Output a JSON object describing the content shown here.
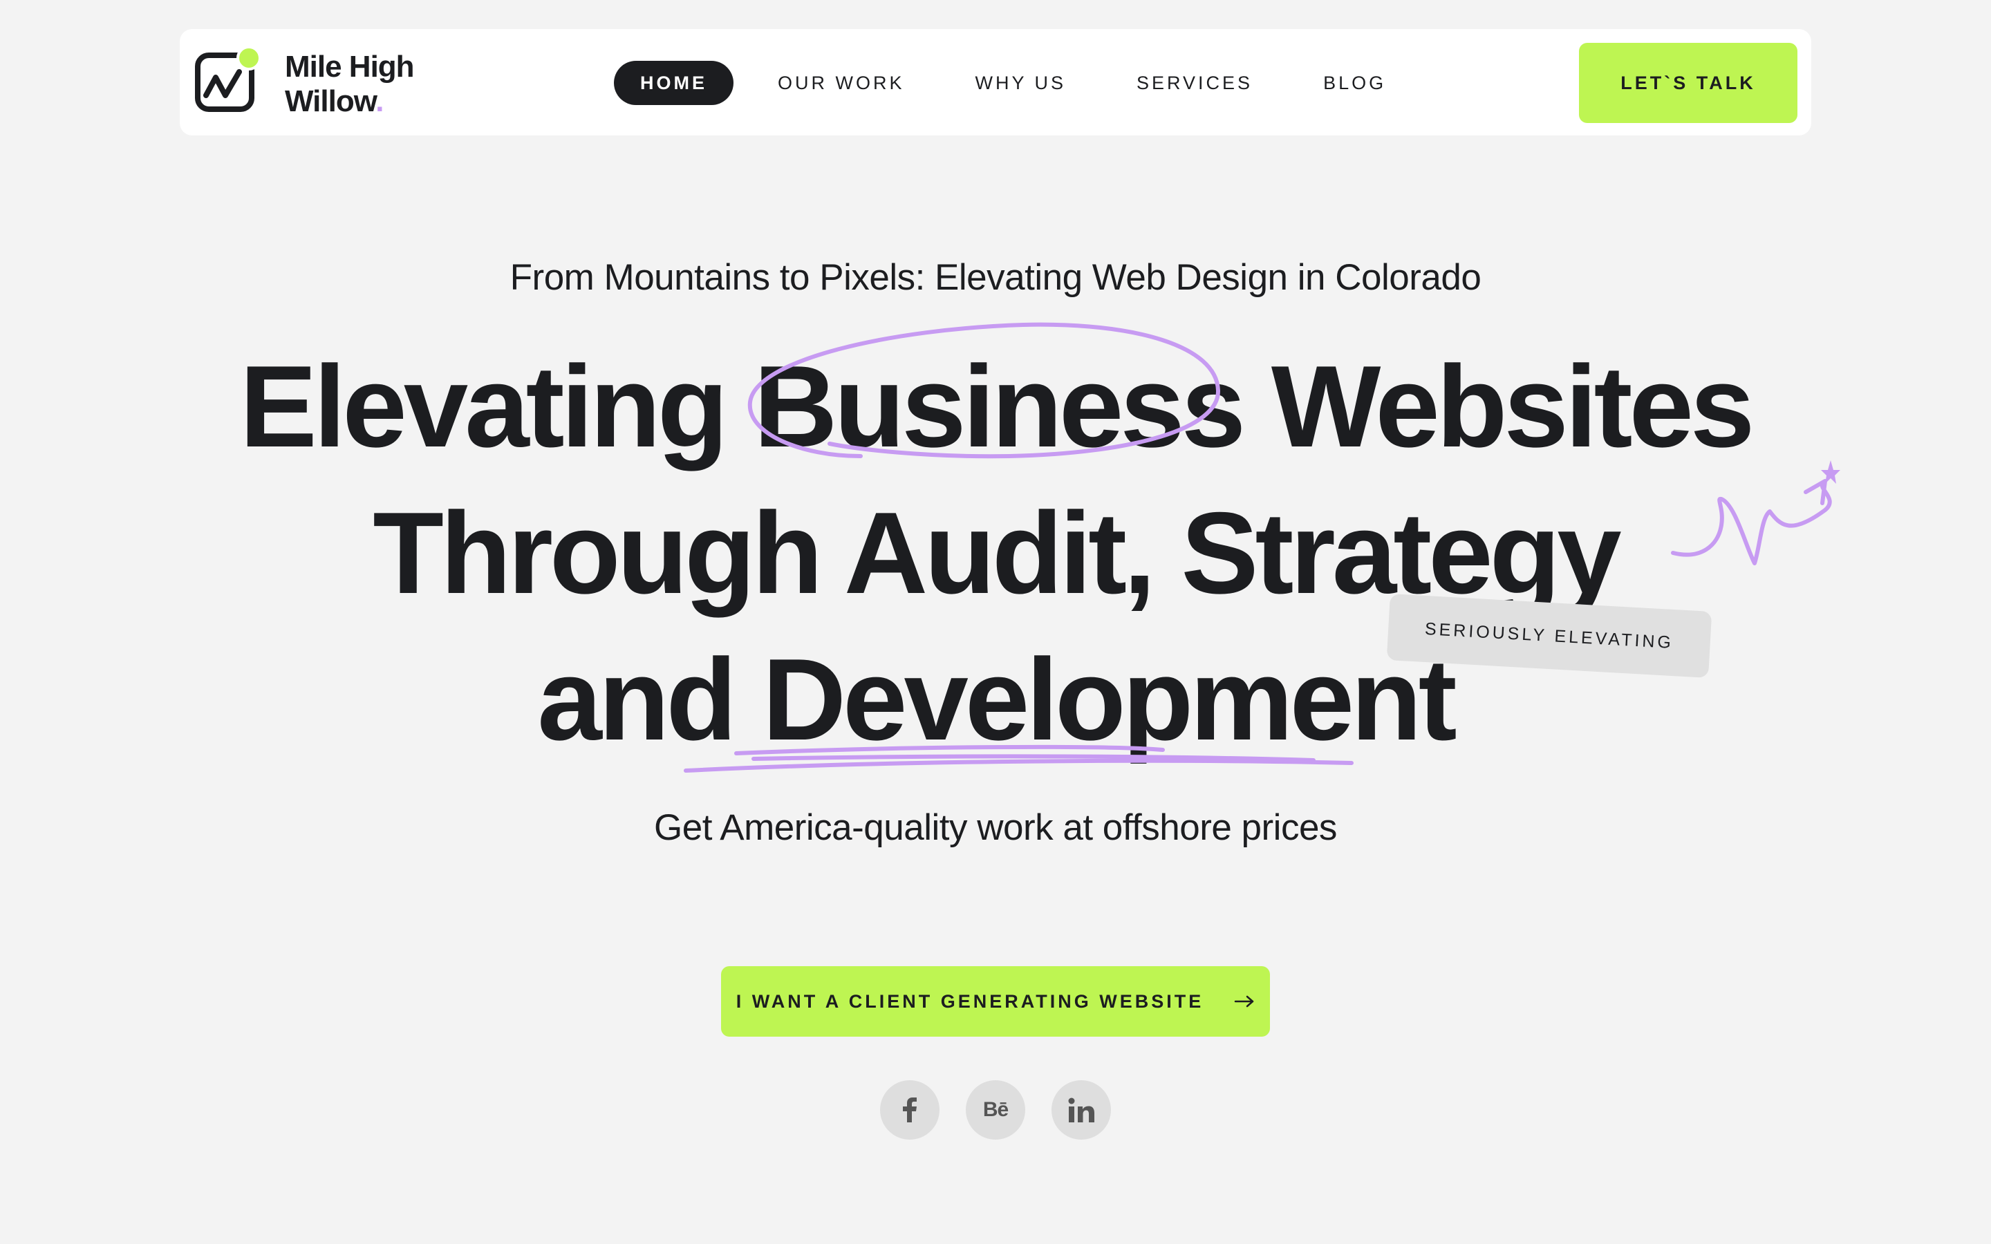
{
  "brand": {
    "name_line1": "Mile High",
    "name_line2": "Willow",
    "name_dot": ".",
    "logo_icon": "chart-line-badge-icon",
    "accent_color": "#bef552",
    "highlight_color": "#c79bf2"
  },
  "nav": {
    "items": [
      {
        "label": "HOME",
        "active": true
      },
      {
        "label": "OUR WORK",
        "active": false
      },
      {
        "label": "WHY US",
        "active": false
      },
      {
        "label": "SERVICES",
        "active": false
      },
      {
        "label": "BLOG",
        "active": false
      }
    ],
    "cta_label": "LET`S TALK"
  },
  "hero": {
    "eyebrow": "From Mountains to Pixels: Elevating Web Design in Colorado",
    "headline_line1": "Elevating Business Websites",
    "headline_line2": "Through Audit, Strategy",
    "headline_line3": "and Development",
    "tag": "SERIOUSLY ELEVATING",
    "subline": "Get America-quality work at offshore prices",
    "cta_label": "I WANT A CLIENT GENERATING WEBSITE",
    "cta_icon": "arrow-right-icon"
  },
  "socials": [
    {
      "name": "facebook",
      "icon": "facebook-icon"
    },
    {
      "name": "behance",
      "icon": "behance-icon",
      "glyph": "Bē"
    },
    {
      "name": "linkedin",
      "icon": "linkedin-icon"
    }
  ]
}
